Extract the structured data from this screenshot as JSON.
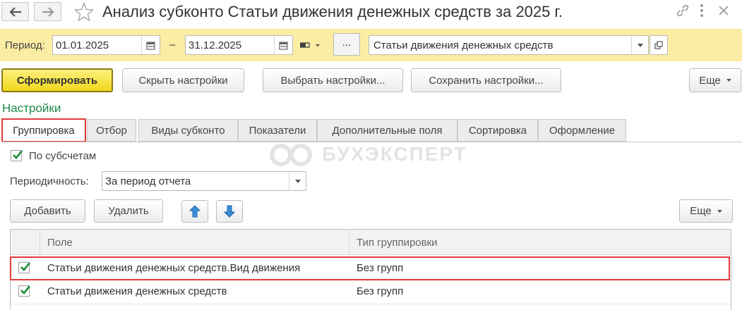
{
  "window": {
    "title": "Анализ субконто Статьи движения денежных средств за 2025 г.",
    "icons": [
      "arrow-left-icon",
      "arrow-right-icon",
      "star-icon",
      "link-icon",
      "more-vertical-icon",
      "close-icon"
    ]
  },
  "period": {
    "label": "Период:",
    "start": "01.01.2025",
    "separator": "–",
    "end": "31.12.2025",
    "ellipsis_label": "...",
    "subconto_type": "Статьи движения денежных средств"
  },
  "toolbar": {
    "generate_label": "Сформировать",
    "hide_settings_label": "Скрыть настройки",
    "choose_settings_label": "Выбрать настройки...",
    "save_settings_label": "Сохранить настройки...",
    "more_label": "Еще"
  },
  "settings": {
    "title": "Настройки",
    "tabs": [
      {
        "label": "Группировка",
        "active": true
      },
      {
        "label": "Отбор"
      },
      {
        "label": "Виды субконто"
      },
      {
        "label": "Показатели"
      },
      {
        "label": "Дополнительные поля"
      },
      {
        "label": "Сортировка"
      },
      {
        "label": "Оформление"
      }
    ]
  },
  "grouping": {
    "by_subaccounts_label": "По субсчетам",
    "by_subaccounts_checked": true,
    "periodicity_label": "Периодичность:",
    "periodicity_value": "За период отчета",
    "add_label": "Добавить",
    "delete_label": "Удалить",
    "more_label": "Еще",
    "columns": [
      "Поле",
      "Тип группировки"
    ],
    "rows": [
      {
        "checked": true,
        "field": "Статьи движения денежных средств.Вид движения",
        "type": "Без групп",
        "highlighted": true
      },
      {
        "checked": true,
        "field": "Статьи движения денежных средств",
        "type": "Без групп"
      }
    ]
  },
  "watermark": "БУХЭКСПЕРТ",
  "colors": {
    "accent_yellow": "#fbeda3",
    "primary_button": "#f2d81d",
    "highlight_red": "#e03b3b",
    "check_green": "#1b8a3a",
    "section_green": "#1e8a46"
  }
}
